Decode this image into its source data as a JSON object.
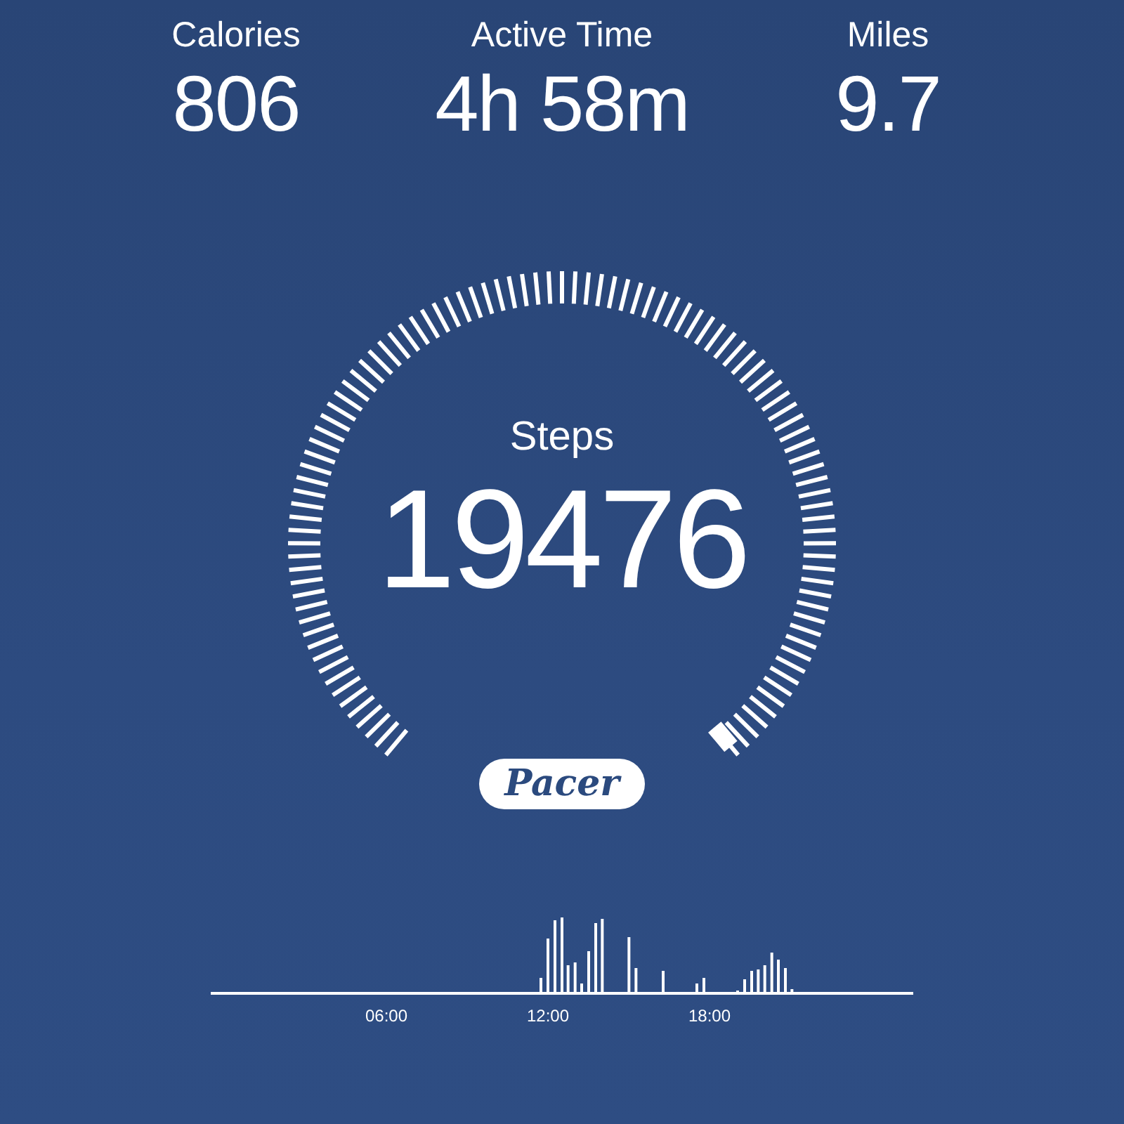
{
  "stats": [
    {
      "label": "Calories",
      "value": "806"
    },
    {
      "label": "Active Time",
      "value": "4h 58m"
    },
    {
      "label": "Miles",
      "value": "9.7"
    }
  ],
  "gauge": {
    "label": "Steps",
    "value": "19476"
  },
  "logo": "Pacer",
  "activity_chart": {
    "x_labels": [
      "06:00",
      "12:00",
      "18:00"
    ]
  }
}
